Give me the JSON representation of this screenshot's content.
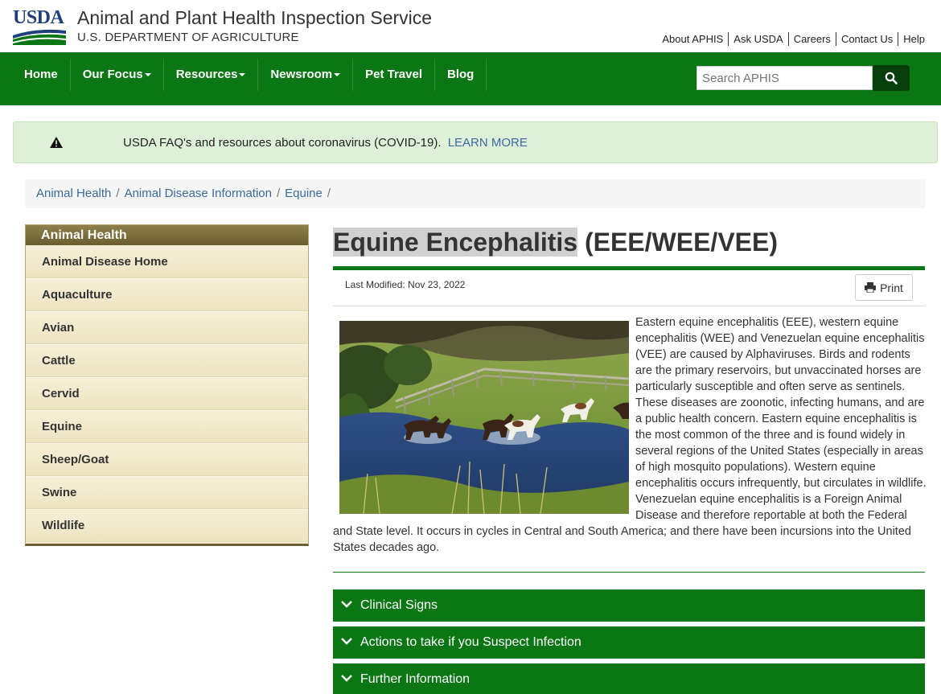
{
  "header": {
    "logo_text": "USDA",
    "agency": "Animal and Plant Health Inspection Service",
    "department": "U.S. DEPARTMENT OF AGRICULTURE",
    "utility_links": [
      "About APHIS",
      "Ask USDA",
      "Careers",
      "Contact Us",
      "Help"
    ]
  },
  "nav": {
    "items": [
      {
        "label": "Home",
        "dropdown": false
      },
      {
        "label": "Our Focus",
        "dropdown": true
      },
      {
        "label": "Resources",
        "dropdown": true
      },
      {
        "label": "Newsroom",
        "dropdown": true
      },
      {
        "label": "Pet Travel",
        "dropdown": false
      },
      {
        "label": "Blog",
        "dropdown": false
      }
    ],
    "search_placeholder": "Search APHIS",
    "search_icon": "search-icon"
  },
  "alert": {
    "icon": "warning-icon",
    "text": "USDA FAQ's and resources about coronavirus (COVID-19).",
    "link": "LEARN MORE"
  },
  "breadcrumb": [
    "Animal Health",
    "Animal Disease Information",
    "Equine"
  ],
  "sidebar": {
    "title": "Animal Health",
    "items": [
      "Animal Disease Home",
      "Aquaculture",
      "Avian",
      "Cattle",
      "Cervid",
      "Equine",
      "Sheep/Goat",
      "Swine",
      "Wildlife"
    ]
  },
  "main": {
    "title_highlight": "Equine Encephalitis",
    "title_rest": " (EEE/WEE/VEE)",
    "last_modified": "Last Modified: Nov 23, 2022",
    "print_label": "Print",
    "body": "Eastern equine encephalitis (EEE), western equine encephalitis (WEE) and Venezuelan equine encephalitis (VEE) are caused by Alphaviruses. Birds and rodents are the primary reservoirs, but unvaccinated horses are particularly susceptible and often serve as sentinels. These diseases are zoonotic, infecting humans, and are a public health concern. Eastern equine encephalitis is the most common of the three and is found widely in several regions of the United States (especially in areas of high mosquito populations). Western equine encephalitis occurs infrequently, but circulates in wildlife. Venezuelan equine encephalitis is a Foreign Animal Disease and therefore reportable at both the Federal and State level. It occurs in cycles in Central and South America; and there have been incursions into the United States decades ago.",
    "accordions": [
      "Clinical Signs",
      "Actions to take if you Suspect Infection",
      "Further Information"
    ]
  },
  "colors": {
    "nav_green": "#0b7614",
    "link_blue": "#3b6aa0",
    "sidebar_bg": "#f2ebd0",
    "sidebar_header": "#7a6b3a",
    "alert_bg": "#dff0d8"
  }
}
